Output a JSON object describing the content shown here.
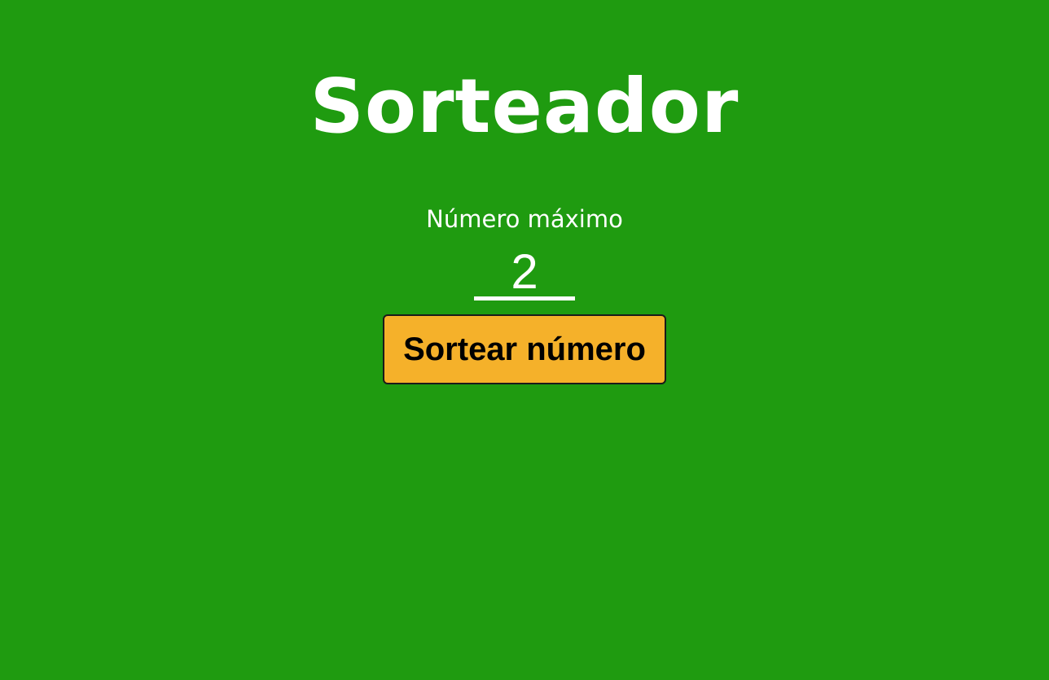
{
  "app": {
    "title": "Sorteador"
  },
  "form": {
    "max_label": "Número máximo",
    "max_value": "2",
    "button_label": "Sortear número"
  },
  "colors": {
    "background": "#1f9b10",
    "text": "#ffffff",
    "button_background": "#f5b12a",
    "button_text": "#000000"
  }
}
